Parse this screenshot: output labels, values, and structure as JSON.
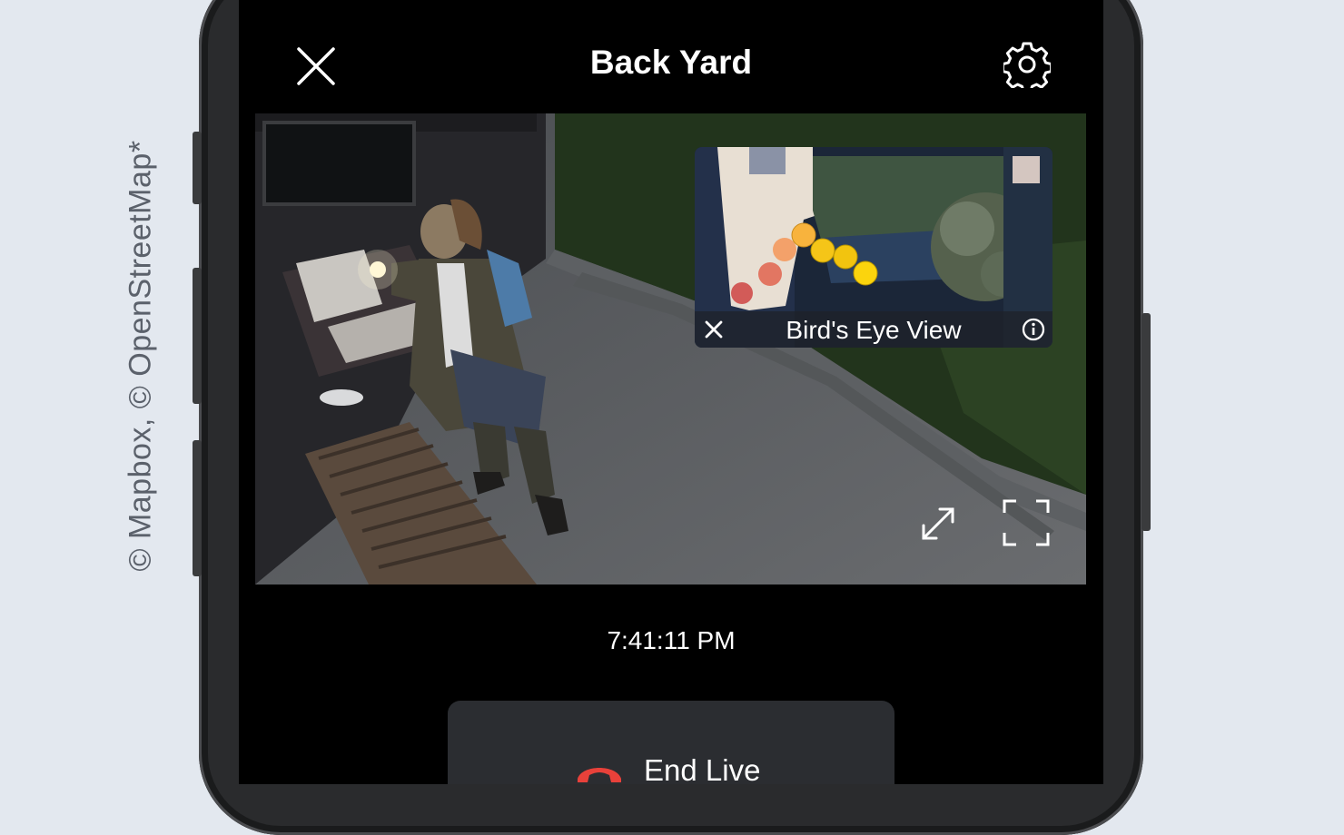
{
  "attribution": "© Mapbox, © OpenStreetMap*",
  "header": {
    "title": "Back Yard",
    "close_icon": "close-icon",
    "settings_icon": "gear-icon"
  },
  "video": {
    "birds_eye": {
      "label": "Bird's Eye View",
      "close_icon": "close-icon",
      "info_icon": "info-icon",
      "path_dot_colors": [
        "#cc3a3a",
        "#e0644e",
        "#f49a5e",
        "#f8b33d",
        "#f5c518",
        "#f2c40f",
        "#fbd40d"
      ]
    },
    "expand_icon": "expand-arrows-icon",
    "fullscreen_icon": "fullscreen-icon"
  },
  "timestamp": "7:41:11 PM",
  "end_live": {
    "label": "End Live",
    "icon": "hang-up-phone-icon",
    "icon_color": "#e8413a"
  }
}
